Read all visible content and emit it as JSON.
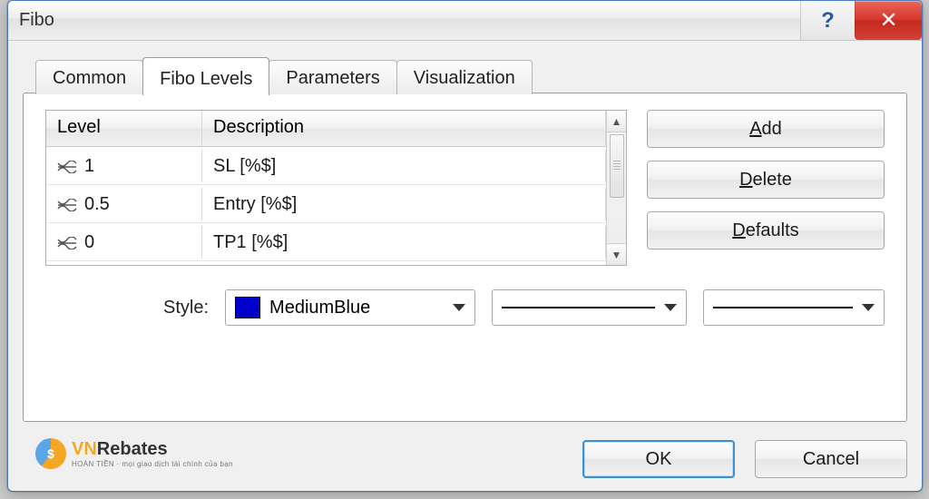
{
  "window": {
    "title": "Fibo"
  },
  "titlebar": {
    "help_glyph": "?",
    "close_glyph": "✕"
  },
  "tabs": [
    {
      "label": "Common"
    },
    {
      "label": "Fibo Levels"
    },
    {
      "label": "Parameters"
    },
    {
      "label": "Visualization"
    }
  ],
  "active_tab_index": 1,
  "grid": {
    "headers": {
      "level": "Level",
      "description": "Description"
    },
    "rows": [
      {
        "level": "1",
        "description": "SL [%$]"
      },
      {
        "level": "0.5",
        "description": "Entry [%$]"
      },
      {
        "level": "0",
        "description": "TP1 [%$]"
      }
    ]
  },
  "side_buttons": {
    "add": {
      "mnemonic": "A",
      "rest": "dd"
    },
    "delete": {
      "mnemonic": "D",
      "rest": "elete"
    },
    "defaults": {
      "mnemonic": "D",
      "rest": "efaults"
    }
  },
  "style": {
    "label": "Style:",
    "color_name": "MediumBlue",
    "color_hex": "#0000CD"
  },
  "footer": {
    "ok": "OK",
    "cancel": "Cancel"
  },
  "watermark": {
    "brand_accent": "VN",
    "brand_rest": "Rebates",
    "tag": "HOÀN TIỀN · mọi giao dịch tài chính của bạn"
  }
}
